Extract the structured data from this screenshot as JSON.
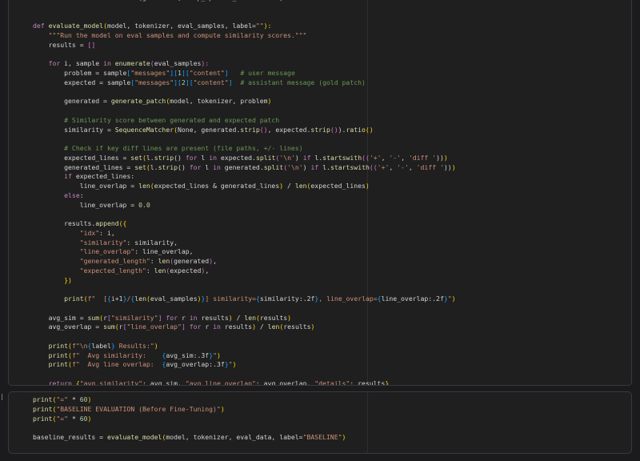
{
  "cells": [
    {
      "id": "cell-1",
      "lines": [
        [
          [
            "  result = tokenizer.decode(generated, skip_special_tokens=True)",
            ""
          ]
        ],
        [
          [
            "",
            ""
          ]
        ],
        [
          [
            "",
            ""
          ]
        ],
        [
          [
            "def ",
            "kw"
          ],
          [
            "evaluate_model",
            "fn"
          ],
          [
            "(",
            "br"
          ],
          [
            "model, tokenizer, eval_samples, label=",
            ""
          ],
          [
            "\"\"",
            "str"
          ],
          [
            "):",
            "br"
          ]
        ],
        [
          [
            "    ",
            ""
          ],
          [
            "\"\"\"Run the model on eval samples and compute similarity scores.\"\"\"",
            "str"
          ]
        ],
        [
          [
            "    results = ",
            ""
          ],
          [
            "[]",
            "bp"
          ]
        ],
        [
          [
            "",
            ""
          ]
        ],
        [
          [
            "    ",
            ""
          ],
          [
            "for ",
            "kw"
          ],
          [
            "i, sample ",
            ""
          ],
          [
            "in ",
            "kw"
          ],
          [
            "enumerate",
            "bi"
          ],
          [
            "(",
            "bp"
          ],
          [
            "eval_samples",
            ""
          ],
          [
            "):",
            "bp"
          ]
        ],
        [
          [
            "        problem = sample",
            ""
          ],
          [
            "[",
            "bb"
          ],
          [
            "\"messages\"",
            "str"
          ],
          [
            "][",
            "bb"
          ],
          [
            "1",
            "num"
          ],
          [
            "][",
            "bb"
          ],
          [
            "\"content\"",
            "str"
          ],
          [
            "]",
            "bb"
          ],
          [
            "   ",
            ""
          ],
          [
            "# user message",
            "cm"
          ]
        ],
        [
          [
            "        expected = sample",
            ""
          ],
          [
            "[",
            "bb"
          ],
          [
            "\"messages\"",
            "str"
          ],
          [
            "][",
            "bb"
          ],
          [
            "2",
            "num"
          ],
          [
            "][",
            "bb"
          ],
          [
            "\"content\"",
            "str"
          ],
          [
            "]",
            "bb"
          ],
          [
            "  ",
            ""
          ],
          [
            "# assistant message (gold patch)",
            "cm"
          ]
        ],
        [
          [
            "",
            ""
          ]
        ],
        [
          [
            "        generated = ",
            ""
          ],
          [
            "generate_patch",
            "fn"
          ],
          [
            "(",
            "br"
          ],
          [
            "model, tokenizer, problem",
            ""
          ],
          [
            ")",
            "br"
          ]
        ],
        [
          [
            "",
            ""
          ]
        ],
        [
          [
            "        ",
            ""
          ],
          [
            "# Similarity score between generated and expected patch",
            "cm"
          ]
        ],
        [
          [
            "        similarity = ",
            ""
          ],
          [
            "SequenceMatcher",
            "fn"
          ],
          [
            "(",
            "br"
          ],
          [
            "None",
            ""
          ],
          [
            ", generated.",
            ""
          ],
          [
            "strip",
            "fn"
          ],
          [
            "()",
            "bp"
          ],
          [
            ", expected.",
            ""
          ],
          [
            "strip",
            "fn"
          ],
          [
            "()",
            "bp"
          ],
          [
            ").",
            ""
          ],
          [
            "ratio",
            "fn"
          ],
          [
            "()",
            "br"
          ]
        ],
        [
          [
            "",
            ""
          ]
        ],
        [
          [
            "        ",
            ""
          ],
          [
            "# Check if key diff lines are present (file paths, +/- lines)",
            "cm"
          ]
        ],
        [
          [
            "        expected_lines = ",
            ""
          ],
          [
            "set",
            "bi"
          ],
          [
            "(",
            "br"
          ],
          [
            "l.",
            ""
          ],
          [
            "strip",
            "fn"
          ],
          [
            "() ",
            ""
          ],
          [
            "for ",
            "kw"
          ],
          [
            "l ",
            ""
          ],
          [
            "in ",
            "kw"
          ],
          [
            "expected.",
            ""
          ],
          [
            "split",
            "fn"
          ],
          [
            "(",
            "bp"
          ],
          [
            "'\\n'",
            "str"
          ],
          [
            ") ",
            ""
          ],
          [
            "if ",
            "kw"
          ],
          [
            "l.",
            ""
          ],
          [
            "startswith",
            "fn"
          ],
          [
            "((",
            "bp"
          ],
          [
            "'+'",
            "str"
          ],
          [
            ", ",
            ""
          ],
          [
            "'-'",
            "str"
          ],
          [
            ", ",
            ""
          ],
          [
            "'diff '",
            "str"
          ],
          [
            "))",
            ""
          ],
          [
            ")",
            "br"
          ]
        ],
        [
          [
            "        generated_lines = ",
            ""
          ],
          [
            "set",
            "bi"
          ],
          [
            "(",
            "br"
          ],
          [
            "l.",
            ""
          ],
          [
            "strip",
            "fn"
          ],
          [
            "() ",
            ""
          ],
          [
            "for ",
            "kw"
          ],
          [
            "l ",
            ""
          ],
          [
            "in ",
            "kw"
          ],
          [
            "generated.",
            ""
          ],
          [
            "split",
            "fn"
          ],
          [
            "(",
            "bp"
          ],
          [
            "'\\n'",
            "str"
          ],
          [
            ") ",
            ""
          ],
          [
            "if ",
            "kw"
          ],
          [
            "l.",
            ""
          ],
          [
            "startswith",
            "fn"
          ],
          [
            "((",
            "bp"
          ],
          [
            "'+'",
            "str"
          ],
          [
            ", ",
            ""
          ],
          [
            "'-'",
            "str"
          ],
          [
            ", ",
            ""
          ],
          [
            "'diff '",
            "str"
          ],
          [
            "))",
            ""
          ],
          [
            ")",
            "br"
          ]
        ],
        [
          [
            "        ",
            ""
          ],
          [
            "if ",
            "kw"
          ],
          [
            "expected_lines:",
            ""
          ]
        ],
        [
          [
            "            line_overlap = ",
            ""
          ],
          [
            "len",
            "bi"
          ],
          [
            "(",
            "br"
          ],
          [
            "expected_lines & generated_lines",
            ""
          ],
          [
            ")",
            "br"
          ],
          [
            " / ",
            ""
          ],
          [
            "len",
            "bi"
          ],
          [
            "(",
            "br"
          ],
          [
            "expected_lines",
            ""
          ],
          [
            ")",
            "br"
          ]
        ],
        [
          [
            "        ",
            ""
          ],
          [
            "else",
            "kw"
          ],
          [
            ":",
            ""
          ]
        ],
        [
          [
            "            line_overlap = ",
            ""
          ],
          [
            "0.0",
            "num"
          ]
        ],
        [
          [
            "",
            ""
          ]
        ],
        [
          [
            "        results.",
            ""
          ],
          [
            "append",
            "fn"
          ],
          [
            "({",
            "br"
          ]
        ],
        [
          [
            "            ",
            ""
          ],
          [
            "\"idx\"",
            "str"
          ],
          [
            ": i,",
            ""
          ]
        ],
        [
          [
            "            ",
            ""
          ],
          [
            "\"similarity\"",
            "str"
          ],
          [
            ": similarity,",
            ""
          ]
        ],
        [
          [
            "            ",
            ""
          ],
          [
            "\"line_overlap\"",
            "str"
          ],
          [
            ": line_overlap,",
            ""
          ]
        ],
        [
          [
            "            ",
            ""
          ],
          [
            "\"generated_length\"",
            "str"
          ],
          [
            ": ",
            ""
          ],
          [
            "len",
            "bi"
          ],
          [
            "(",
            "bp"
          ],
          [
            "generated",
            ""
          ],
          [
            ")",
            "bp"
          ],
          [
            ",",
            ""
          ]
        ],
        [
          [
            "            ",
            ""
          ],
          [
            "\"expected_length\"",
            "str"
          ],
          [
            ": ",
            ""
          ],
          [
            "len",
            "bi"
          ],
          [
            "(",
            "bp"
          ],
          [
            "expected",
            ""
          ],
          [
            ")",
            "bp"
          ],
          [
            ",",
            ""
          ]
        ],
        [
          [
            "        ",
            ""
          ],
          [
            "})",
            "br"
          ]
        ],
        [
          [
            "",
            ""
          ]
        ],
        [
          [
            "        ",
            ""
          ],
          [
            "print",
            "bi"
          ],
          [
            "(",
            "br"
          ],
          [
            "f\"  [",
            "str"
          ],
          [
            "{",
            "bb"
          ],
          [
            "i+1",
            ""
          ],
          [
            "}",
            "bb"
          ],
          [
            "/",
            "str"
          ],
          [
            "{",
            "bb"
          ],
          [
            "len",
            "bi"
          ],
          [
            "(",
            "br"
          ],
          [
            "eval_samples",
            ""
          ],
          [
            ")",
            "br"
          ],
          [
            "}",
            "bb"
          ],
          [
            "] similarity=",
            "str"
          ],
          [
            "{",
            "bb"
          ],
          [
            "similarity:.2f",
            ""
          ],
          [
            "}",
            "bb"
          ],
          [
            ", line_overlap=",
            "str"
          ],
          [
            "{",
            "bb"
          ],
          [
            "line_overlap:.2f",
            ""
          ],
          [
            "}",
            "bb"
          ],
          [
            "\"",
            "str"
          ],
          [
            ")",
            "br"
          ]
        ],
        [
          [
            "",
            ""
          ]
        ],
        [
          [
            "    avg_sim = ",
            ""
          ],
          [
            "sum",
            "bi"
          ],
          [
            "(",
            "br"
          ],
          [
            "r",
            ""
          ],
          [
            "[",
            "bp"
          ],
          [
            "\"similarity\"",
            "str"
          ],
          [
            "]",
            "bp"
          ],
          [
            " ",
            ""
          ],
          [
            "for ",
            "kw"
          ],
          [
            "r ",
            ""
          ],
          [
            "in ",
            "kw"
          ],
          [
            "results",
            ""
          ],
          [
            ")",
            "br"
          ],
          [
            " / ",
            ""
          ],
          [
            "len",
            "bi"
          ],
          [
            "(",
            "br"
          ],
          [
            "results",
            ""
          ],
          [
            ")",
            "br"
          ]
        ],
        [
          [
            "    avg_overlap = ",
            ""
          ],
          [
            "sum",
            "bi"
          ],
          [
            "(",
            "br"
          ],
          [
            "r",
            ""
          ],
          [
            "[",
            "bp"
          ],
          [
            "\"line_overlap\"",
            "str"
          ],
          [
            "]",
            "bp"
          ],
          [
            " ",
            ""
          ],
          [
            "for ",
            "kw"
          ],
          [
            "r ",
            ""
          ],
          [
            "in ",
            "kw"
          ],
          [
            "results",
            ""
          ],
          [
            ")",
            "br"
          ],
          [
            " / ",
            ""
          ],
          [
            "len",
            "bi"
          ],
          [
            "(",
            "br"
          ],
          [
            "results",
            ""
          ],
          [
            ")",
            "br"
          ]
        ],
        [
          [
            "",
            ""
          ]
        ],
        [
          [
            "    ",
            ""
          ],
          [
            "print",
            "bi"
          ],
          [
            "(",
            "br"
          ],
          [
            "f\"\\n",
            "str"
          ],
          [
            "{",
            "bb"
          ],
          [
            "label",
            ""
          ],
          [
            "}",
            "bb"
          ],
          [
            " Results:\"",
            "str"
          ],
          [
            ")",
            "br"
          ]
        ],
        [
          [
            "    ",
            ""
          ],
          [
            "print",
            "bi"
          ],
          [
            "(",
            "br"
          ],
          [
            "f\"  Avg similarity:    ",
            "str"
          ],
          [
            "{",
            "bb"
          ],
          [
            "avg_sim:.3f",
            ""
          ],
          [
            "}",
            "bb"
          ],
          [
            "\"",
            "str"
          ],
          [
            ")",
            "br"
          ]
        ],
        [
          [
            "    ",
            ""
          ],
          [
            "print",
            "bi"
          ],
          [
            "(",
            "br"
          ],
          [
            "f\"  Avg line overlap:  ",
            "str"
          ],
          [
            "{",
            "bb"
          ],
          [
            "avg_overlap:.3f",
            ""
          ],
          [
            "}",
            "bb"
          ],
          [
            "\"",
            "str"
          ],
          [
            ")",
            "br"
          ]
        ],
        [
          [
            "",
            ""
          ]
        ],
        [
          [
            "    ",
            ""
          ],
          [
            "return ",
            "kw"
          ],
          [
            "{",
            "br"
          ],
          [
            "\"avg_similarity\"",
            "str"
          ],
          [
            ": avg_sim, ",
            ""
          ],
          [
            "\"avg_line_overlap\"",
            "str"
          ],
          [
            ": avg_overlap, ",
            ""
          ],
          [
            "\"details\"",
            "str"
          ],
          [
            ": results",
            ""
          ],
          [
            "}",
            "br"
          ]
        ]
      ]
    },
    {
      "id": "cell-2",
      "lines": [
        [
          [
            "print",
            "bi"
          ],
          [
            "(",
            "br"
          ],
          [
            "\"=\"",
            "str"
          ],
          [
            " * ",
            ""
          ],
          [
            "60",
            "num"
          ],
          [
            ")",
            "br"
          ]
        ],
        [
          [
            "print",
            "bi"
          ],
          [
            "(",
            "br"
          ],
          [
            "\"BASELINE EVALUATION (Before Fine-Tuning)\"",
            "str"
          ],
          [
            ")",
            "br"
          ]
        ],
        [
          [
            "print",
            "bi"
          ],
          [
            "(",
            "br"
          ],
          [
            "\"=\"",
            "str"
          ],
          [
            " * ",
            ""
          ],
          [
            "60",
            "num"
          ],
          [
            ")",
            "br"
          ]
        ],
        [
          [
            "",
            ""
          ]
        ],
        [
          [
            "baseline_results = ",
            ""
          ],
          [
            "evaluate_model",
            "fn"
          ],
          [
            "(",
            "br"
          ],
          [
            "model, tokenizer, eval_data, label=",
            ""
          ],
          [
            "\"BASELINE\"",
            "str"
          ],
          [
            ")",
            "br"
          ]
        ]
      ]
    }
  ]
}
